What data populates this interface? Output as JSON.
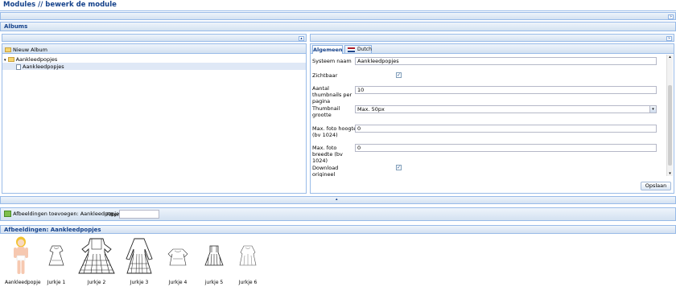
{
  "page": {
    "title": "Modules // bewerk de module"
  },
  "albums_panel": {
    "title": "Albums"
  },
  "tree": {
    "new_album_label": "Nieuw Album",
    "root": "Aankleedpopjes",
    "child": "Aankleedpopjes"
  },
  "tabs": [
    {
      "label": "Algemeen"
    },
    {
      "label": "Dutch"
    }
  ],
  "form": {
    "systeem_naam": {
      "label": "Systeem naam",
      "value": "Aankleedpopjes"
    },
    "zichtbaar": {
      "label": "Zichtbaar",
      "checked": true
    },
    "thumbs_per_page": {
      "label": "Aantal thumbnails per pagina",
      "value": "10"
    },
    "thumb_size": {
      "label": "Thumbnail grootte",
      "value": "Max. 50px"
    },
    "max_height": {
      "label": "Max. foto hoogte (bv 1024)",
      "value": "0"
    },
    "max_width": {
      "label": "Max. foto breedte (bv 1024)",
      "value": "0"
    },
    "download": {
      "label": "Download origineel",
      "checked": true
    },
    "save_label": "Opslaan"
  },
  "toolbar": {
    "add_images_label": "Afbeeldingen toevoegen: Aankleedpopjes",
    "filter_label": "Filter:",
    "filter_value": ""
  },
  "images_panel": {
    "title": "Afbeeldingen: Aankleedpopjes",
    "items": [
      {
        "caption": "Aankleedpopje"
      },
      {
        "caption": "Jurkje 1"
      },
      {
        "caption": "Jurkje 2"
      },
      {
        "caption": "Jurkje 3"
      },
      {
        "caption": "Jurkje 4"
      },
      {
        "caption": "jurkje 5"
      },
      {
        "caption": "Jurkje 6"
      }
    ]
  }
}
